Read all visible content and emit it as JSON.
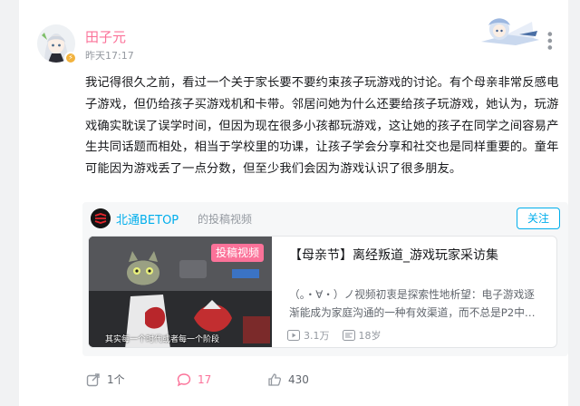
{
  "post": {
    "username": "田子元",
    "timestamp": "昨天17:17",
    "text": "我记得很久之前，看过一个关于家长要不要约束孩子玩游戏的讨论。有个母亲非常反感电子游戏，但仍给孩子买游戏机和卡带。邻居问她为什么还要给孩子玩游戏，她认为，玩游戏确实耽误了误学时间，但因为现在很多小孩都玩游戏，这让她的孩子在同学之间容易产生共同话题而相处，相当于学校里的功课，让孩子学会分享和社交也是同样重要的。童年可能因为游戏丢了一点分数，但至少我们会因为游戏认识了很多朋友。"
  },
  "repost": {
    "up_name": "北通BETOP",
    "up_desc": "的投稿视频",
    "follow_label": "关注",
    "video": {
      "tag": "投稿视频",
      "subtitle": "其实每一个时代或者每一个阶段",
      "title": "【母亲节】离经叛道_游戏玩家采访集",
      "desc": "（。・∀・）ノ视频初衷是探索性地析望：电子游戏逐渐能成为家庭沟通的一种有效渠道，而不总是P2中…",
      "plays": "3.1万",
      "danmaku": "18岁"
    }
  },
  "actions": {
    "share": "1个",
    "comment": "17",
    "like": "430"
  },
  "colors": {
    "accent": "#00aeec",
    "pink": "#fb7299"
  },
  "icons": [
    "more-icon",
    "verified-badge-icon",
    "play-icon",
    "danmaku-icon",
    "share-icon",
    "comment-icon",
    "like-icon"
  ]
}
